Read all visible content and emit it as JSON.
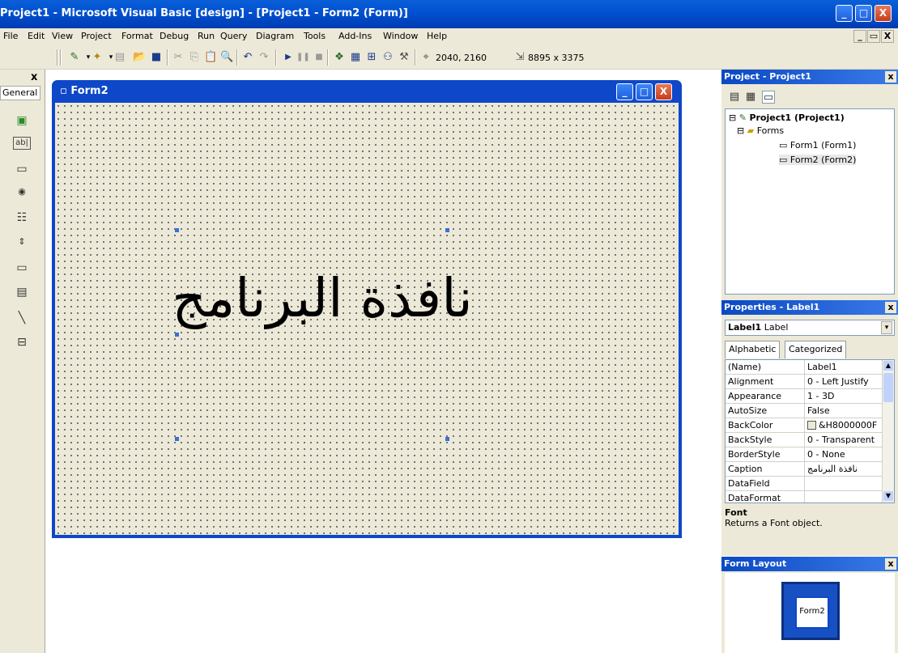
{
  "window": {
    "title": "Project1 - Microsoft Visual Basic [design] - [Project1 - Form2 (Form)]",
    "controls": {
      "minimize": "_",
      "maximize": "□",
      "close": "X"
    }
  },
  "menu": [
    "File",
    "Edit",
    "View",
    "Project",
    "Format",
    "Debug",
    "Run",
    "Query",
    "Diagram",
    "Tools",
    "Add-Ins",
    "Window",
    "Help"
  ],
  "mdi_controls": {
    "minimize": "_",
    "restore": "▭",
    "close": "X"
  },
  "toolbar": {
    "position_readout": "2040, 2160",
    "size_readout": "8895 x 3375"
  },
  "toolbox": {
    "close": "x",
    "tab_label": "General"
  },
  "form_window": {
    "title": "Form2",
    "label_caption": "نافذة البرنامج"
  },
  "project_panel": {
    "title": "Project - Project1",
    "close": "x",
    "tree": {
      "root": "Project1 (Project1)",
      "folder": "Forms",
      "items": [
        "Form1 (Form1)",
        "Form2 (Form2)"
      ]
    }
  },
  "properties_panel": {
    "title": "Properties - Label1",
    "close": "x",
    "object_name": "Label1",
    "object_type": "Label",
    "tabs": [
      "Alphabetic",
      "Categorized"
    ],
    "rows": [
      {
        "key": "(Name)",
        "value": "Label1"
      },
      {
        "key": "Alignment",
        "value": "0 - Left Justify"
      },
      {
        "key": "Appearance",
        "value": "1 - 3D"
      },
      {
        "key": "AutoSize",
        "value": "False"
      },
      {
        "key": "BackColor",
        "value": "&H8000000F"
      },
      {
        "key": "BackStyle",
        "value": "0 - Transparent"
      },
      {
        "key": "BorderStyle",
        "value": "0 - None"
      },
      {
        "key": "Caption",
        "value": "نافذة البرنامج"
      },
      {
        "key": "DataField",
        "value": ""
      },
      {
        "key": "DataFormat",
        "value": ""
      }
    ],
    "description_title": "Font",
    "description_text": "Returns a Font object."
  },
  "layout_panel": {
    "title": "Form Layout",
    "close": "x",
    "form_name": "Form2"
  },
  "colors": {
    "xp_blue": "#0150d0",
    "form_face": "#ece9d8",
    "close_red": "#c63b1b"
  }
}
